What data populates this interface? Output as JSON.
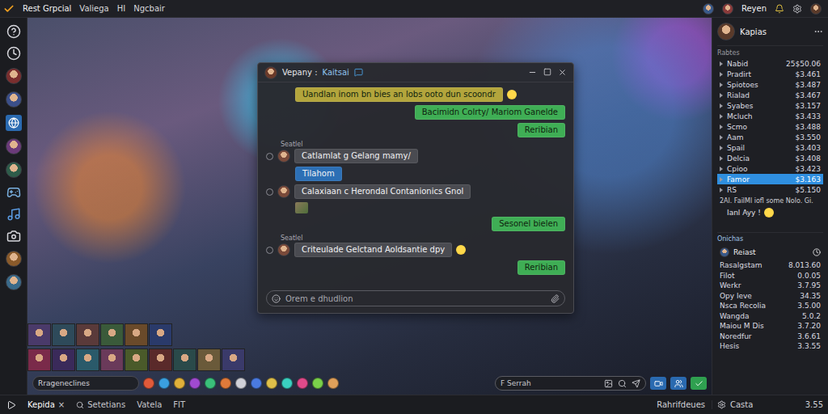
{
  "topbar": {
    "brand": "Rest Grpcial",
    "menu": [
      "Valiega",
      "HI",
      "Ngcbair"
    ],
    "user": "Reyen"
  },
  "chat": {
    "title": "Vepany :",
    "status": "Kaitsai",
    "placeholder": "Orem e dhudlion",
    "messages": [
      {
        "kind": "highlight",
        "sender": "",
        "text": "Uandlan inom bn bies an lobs ooto dun scoondr",
        "reaction": true
      },
      {
        "kind": "outgoing",
        "sender": "",
        "text": "Bacimidn Colrty/ Mariom Ganelde",
        "reaction": false
      },
      {
        "kind": "outgoing",
        "sender": "",
        "text": "Reribian",
        "reaction": false
      },
      {
        "kind": "incoming",
        "sender": "Seatlel",
        "text": "Catlamlat g Gelang mamy/",
        "reaction": false
      },
      {
        "kind": "chip",
        "sender": "",
        "text": "Tilahom",
        "reaction": false
      },
      {
        "kind": "incoming",
        "sender": "",
        "text": "Calaxiaan c Herondal Contanionics Gnol",
        "reaction": false
      },
      {
        "kind": "image",
        "sender": "",
        "text": "",
        "reaction": false
      },
      {
        "kind": "outgoing",
        "sender": "",
        "text": "Sesonel bielen",
        "reaction": false
      },
      {
        "kind": "incoming",
        "sender": "Seatlel",
        "text": "Criteulade Gelctand Aoldsantie dpy",
        "reaction": true
      },
      {
        "kind": "outgoing",
        "sender": "",
        "text": "Reribian",
        "reaction": false
      }
    ]
  },
  "composer": {
    "text": "Rrageneclines"
  },
  "search": {
    "placeholder": "F Serrah"
  },
  "panel": {
    "title": "Kapias",
    "section": "Rabtes",
    "items": [
      {
        "name": "Nabid",
        "value": "25$50.06",
        "selected": false
      },
      {
        "name": "Pradirt",
        "value": "$3.461",
        "selected": false
      },
      {
        "name": "Spiotoes",
        "value": "$3.487",
        "selected": false
      },
      {
        "name": "Rialad",
        "value": "$3.467",
        "selected": false
      },
      {
        "name": "Syabes",
        "value": "$3.157",
        "selected": false
      },
      {
        "name": "Mcluch",
        "value": "$3.433",
        "selected": false
      },
      {
        "name": "Scmo",
        "value": "$3.488",
        "selected": false
      },
      {
        "name": "Aam",
        "value": "$3.550",
        "selected": false
      },
      {
        "name": "Spail",
        "value": "$3.403",
        "selected": false
      },
      {
        "name": "Delcia",
        "value": "$3.408",
        "selected": false
      },
      {
        "name": "Cpioo",
        "value": "$3.423",
        "selected": false
      },
      {
        "name": "Famor",
        "value": "$3.163",
        "selected": true
      },
      {
        "name": "RS",
        "value": "$5.150",
        "selected": false
      }
    ],
    "note": "2Al. FailMl iofl some Nolo. Gi.",
    "tag": "Ianl Ayy !",
    "section2": "Onichas",
    "contact": "Reiast",
    "rows": [
      {
        "name": "Rasalgstam",
        "value": "8.013.60"
      },
      {
        "name": "Filot",
        "value": "0.0.05"
      },
      {
        "name": "Werkr",
        "value": "3.7.95"
      },
      {
        "name": "Opy leve",
        "value": "34.35"
      },
      {
        "name": "Nsca Recolia",
        "value": "3.5.00"
      },
      {
        "name": "Wangda",
        "value": "5.0.2"
      },
      {
        "name": "Maiou M Dis",
        "value": "3.7.20"
      },
      {
        "name": "Noredfur",
        "value": "3.6.61"
      },
      {
        "name": "Hesis",
        "value": "3.3.55"
      }
    ]
  },
  "bottombar": {
    "tabs": [
      {
        "label": "Kepida",
        "close": "×",
        "selected": true
      },
      {
        "label": "Setetians",
        "close": "",
        "selected": false
      },
      {
        "label": "Vatela",
        "close": "",
        "selected": false
      },
      {
        "label": "FIT",
        "close": "",
        "selected": false
      }
    ],
    "status": "Rahrifdeues",
    "footer": {
      "name": "Casta",
      "value": "3.55"
    }
  }
}
